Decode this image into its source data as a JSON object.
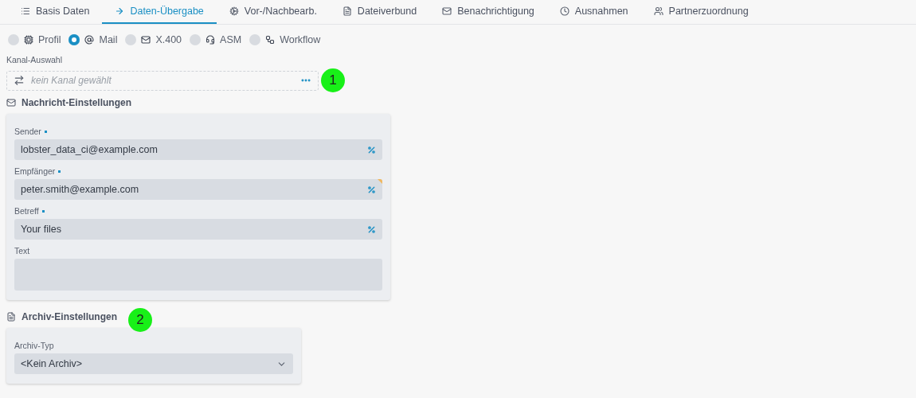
{
  "tabs": [
    {
      "label": "Basis Daten",
      "selected": false
    },
    {
      "label": "Daten-Übergabe",
      "selected": true
    },
    {
      "label": "Vor-/Nachbearb.",
      "selected": false
    },
    {
      "label": "Dateiverbund",
      "selected": false
    },
    {
      "label": "Benachrichtigung",
      "selected": false
    },
    {
      "label": "Ausnahmen",
      "selected": false
    },
    {
      "label": "Partnerzuordnung",
      "selected": false
    }
  ],
  "channel_types": [
    {
      "label": "Profil",
      "selected": false
    },
    {
      "label": "Mail",
      "selected": true
    },
    {
      "label": "X.400",
      "selected": false
    },
    {
      "label": "ASM",
      "selected": false
    },
    {
      "label": "Workflow",
      "selected": false
    }
  ],
  "channel": {
    "label": "Kanal-Auswahl",
    "placeholder": "kein Kanal gewählt",
    "marker": "1"
  },
  "message": {
    "title": "Nachricht-Einstellungen",
    "fields": [
      {
        "kind": "input",
        "label": "Sender",
        "required": true,
        "value": "lobster_data_ci@example.com",
        "modified": false
      },
      {
        "kind": "input",
        "label": "Empfänger",
        "required": true,
        "value": "peter.smith@example.com",
        "modified": true
      },
      {
        "kind": "input",
        "label": "Betreff",
        "required": true,
        "value": "Your files",
        "modified": false
      },
      {
        "kind": "textarea",
        "label": "Text",
        "required": false,
        "modified": false
      }
    ]
  },
  "archive": {
    "title": "Archiv-Einstellungen",
    "marker": "2",
    "type_label": "Archiv-Typ",
    "type_value": "<Kein Archiv>"
  }
}
